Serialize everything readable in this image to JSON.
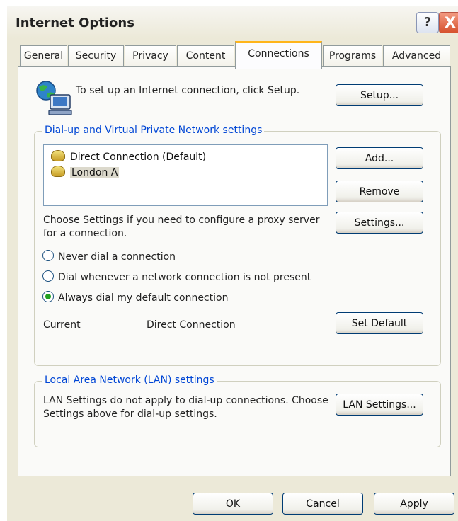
{
  "window": {
    "title": "Internet Options",
    "help_label": "?",
    "close_label": "X"
  },
  "tabs": [
    "General",
    "Security",
    "Privacy",
    "Content",
    "Connections",
    "Programs",
    "Advanced"
  ],
  "active_tab": "Connections",
  "setup": {
    "text": "To set up an Internet connection, click Setup.",
    "button": "Setup..."
  },
  "dialup": {
    "legend": "Dial-up and Virtual Private Network settings",
    "connections": [
      "Direct Connection (Default)",
      "London A"
    ],
    "selected_connection": "London A",
    "add_button": "Add...",
    "remove_button": "Remove",
    "settings_text": "Choose Settings if you need to configure a proxy server for a connection.",
    "settings_button": "Settings...",
    "options": [
      "Never dial a connection",
      "Dial whenever a network connection is not present",
      "Always dial my default connection"
    ],
    "selected_option": "Always dial my default connection",
    "current_label": "Current",
    "current_value": "Direct Connection",
    "set_default_button": "Set Default"
  },
  "lan": {
    "legend": "Local Area Network (LAN) settings",
    "text": "LAN Settings do not apply to dial-up connections. Choose Settings above for dial-up settings.",
    "button": "LAN Settings..."
  },
  "footer": {
    "ok": "OK",
    "cancel": "Cancel",
    "apply": "Apply"
  },
  "colors": {
    "dialog_bg": "#ece9d8",
    "panel_bg": "#fafaf8",
    "active_tab_accent": "#ffb51a",
    "group_label": "#0046d5",
    "close_button": "#d7522e"
  }
}
